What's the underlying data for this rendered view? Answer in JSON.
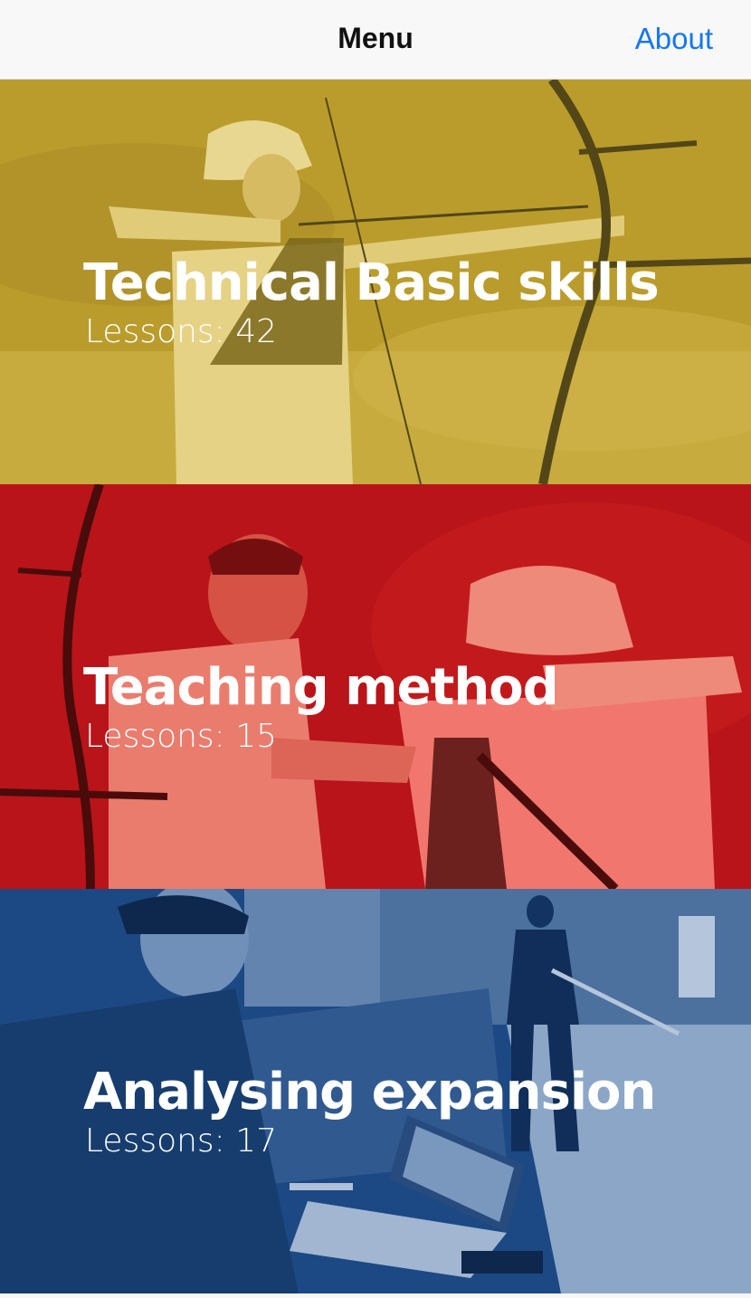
{
  "navbar": {
    "title": "Menu",
    "about_label": "About",
    "about_color": "#1677f0"
  },
  "categories": [
    {
      "title": "Technical Basic skills",
      "lessons_label": "Lessons: 42",
      "tint": "#c8a828"
    },
    {
      "title": "Teaching method",
      "lessons_label": "Lessons: 15",
      "tint": "#c8181a"
    },
    {
      "title": "Analysing expansion",
      "lessons_label": "Lessons: 17",
      "tint": "#1c4a86"
    }
  ]
}
